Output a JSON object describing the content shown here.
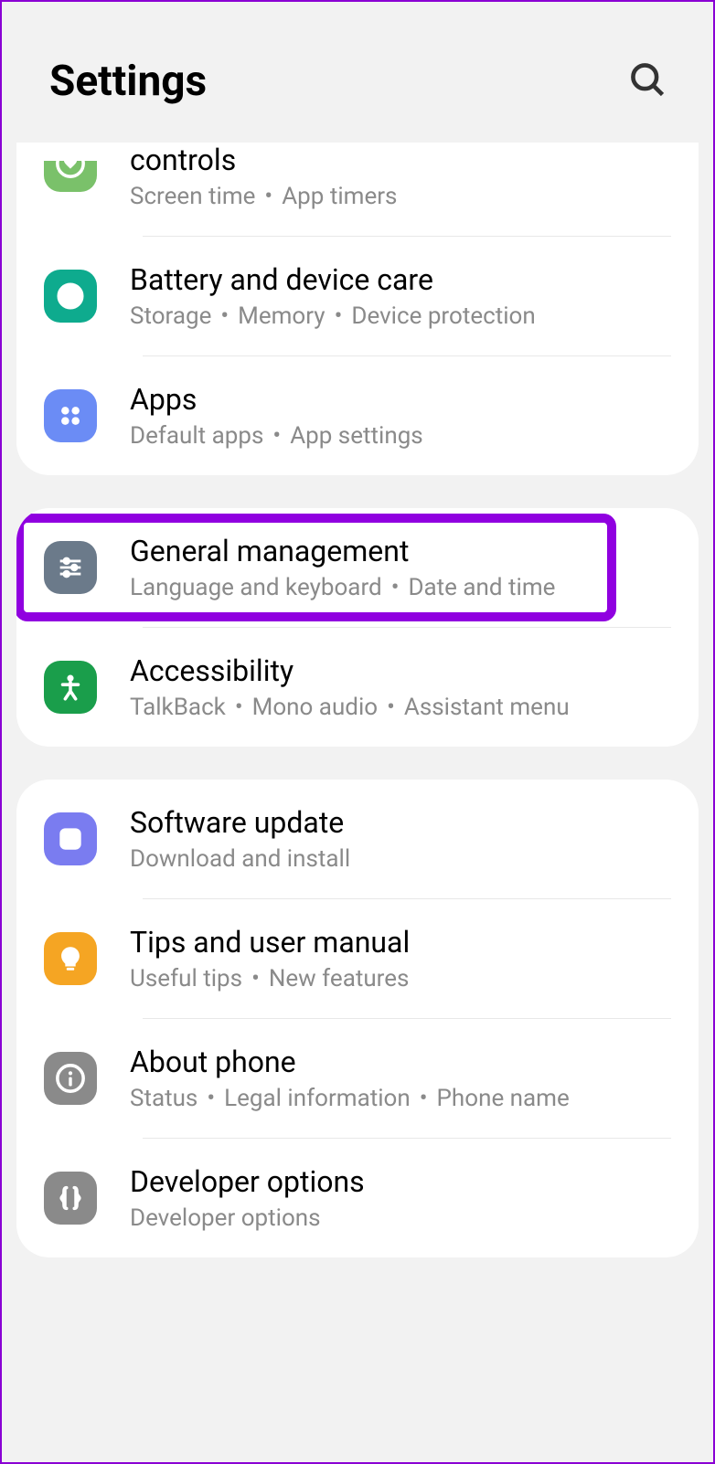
{
  "header": {
    "title": "Settings"
  },
  "groups": [
    {
      "items": [
        {
          "id": "controls",
          "title": "controls",
          "subtitle": [
            "Screen time",
            "App timers"
          ],
          "iconColor": "green-light",
          "icon": "heart-circle",
          "cut": true
        },
        {
          "id": "battery",
          "title": "Battery and device care",
          "subtitle": [
            "Storage",
            "Memory",
            "Device protection"
          ],
          "iconColor": "teal",
          "icon": "target"
        },
        {
          "id": "apps",
          "title": "Apps",
          "subtitle": [
            "Default apps",
            "App settings"
          ],
          "iconColor": "blue",
          "icon": "grid4"
        }
      ]
    },
    {
      "items": [
        {
          "id": "general",
          "title": "General management",
          "subtitle": [
            "Language and keyboard",
            "Date and time"
          ],
          "iconColor": "slate",
          "icon": "sliders",
          "highlighted": true
        },
        {
          "id": "accessibility",
          "title": "Accessibility",
          "subtitle": [
            "TalkBack",
            "Mono audio",
            "Assistant menu"
          ],
          "iconColor": "green",
          "icon": "person"
        }
      ]
    },
    {
      "items": [
        {
          "id": "software",
          "title": "Software update",
          "subtitle": [
            "Download and install"
          ],
          "iconColor": "violet",
          "icon": "download"
        },
        {
          "id": "tips",
          "title": "Tips and user manual",
          "subtitle": [
            "Useful tips",
            "New features"
          ],
          "iconColor": "orange",
          "icon": "bulb"
        },
        {
          "id": "about",
          "title": "About phone",
          "subtitle": [
            "Status",
            "Legal information",
            "Phone name"
          ],
          "iconColor": "gray",
          "icon": "info"
        },
        {
          "id": "developer",
          "title": "Developer options",
          "subtitle": [
            "Developer options"
          ],
          "iconColor": "gray",
          "icon": "braces"
        }
      ]
    }
  ]
}
